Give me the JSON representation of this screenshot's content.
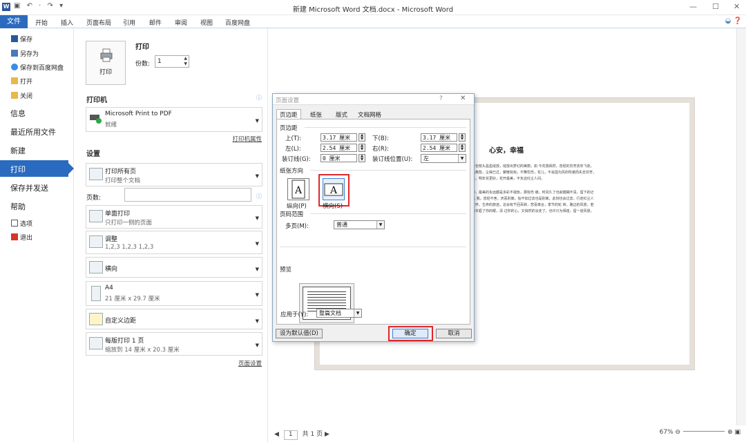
{
  "window": {
    "app_icon": "W",
    "quick_access": "▣ ↶ · ↷ ▾",
    "title": "新建 Microsoft Word 文档.docx - Microsoft Word",
    "minimize": "—",
    "maximize": "☐",
    "close": "✕"
  },
  "ribbon": {
    "file_tab": "文件",
    "tabs": [
      "开始",
      "插入",
      "页面布局",
      "引用",
      "邮件",
      "审阅",
      "视图",
      "百度网盘"
    ]
  },
  "nav": {
    "save": "保存",
    "save_as": "另存为",
    "save_to_baidu": "保存到百度网盘",
    "open": "打开",
    "close": "关闭",
    "info": "信息",
    "recent": "最近所用文件",
    "new": "新建",
    "print": "打印",
    "save_send": "保存并发送",
    "help": "帮助",
    "options": "选项",
    "exit": "退出"
  },
  "print_panel": {
    "print_button": "打印",
    "heading": "打印",
    "copies_label": "份数:",
    "copies_value": "1",
    "printer_heading": "打印机",
    "printer_name": "Microsoft Print to PDF",
    "printer_status": "就绪",
    "printer_props": "打印机属性",
    "settings_heading": "设置",
    "print_all_title": "打印所有页",
    "print_all_sub": "打印整个文档",
    "pages_label": "页数:",
    "one_sided_title": "单面打印",
    "one_sided_sub": "只打印一侧的页面",
    "collate_title": "调整",
    "collate_sub": "1,2,3    1,2,3    1,2,3",
    "orientation_title": "横向",
    "paper_title": "A4",
    "paper_sub": "21 厘米 x 29.7 厘米",
    "margins_title": "自定义边距",
    "per_sheet_title": "每版打印 1 页",
    "per_sheet_sub": "缩放到 14 厘米 x 20.3 厘米",
    "page_setup_link": "页面设置"
  },
  "preview": {
    "doc_title": "心安，幸福",
    "para_lines": [
      "着也枝头盈盈绽放，绽放出梦幻的美丽，如 今花落嫣然，曾经的芬芳流年飞逝。",
      "是离愁，尘缘已过，聚散匆匆，不舞忧伤，花儿，不会因为风的吹袭而失去芬芳，",
      "以，明年花更好，花开最美，不负这红尘人间。",
      "中，最美的永远都是多彩不褪色，那些伤 痛，时间久了也就模糊不清。留下的记",
      "北 我，曾经不舍，厌恶别离，始不如过去也是别离，此刻也会过去。行走红尘人",
      "胜怀，生命的旅途，总会有千回百转，悲喜离合，季节的轮 转，路边的风景，若",
      "也许捱了你的眼，清 过你的心，又悄然的淡走了，也许只为相逢，留一道风景。"
    ],
    "page_label": "1",
    "page_total": "共 1 页",
    "zoom_level": "67%"
  },
  "dialog": {
    "title": "页面设置",
    "help": "?",
    "close": "✕",
    "tabs": [
      "页边距",
      "纸张",
      "版式",
      "文档网格"
    ],
    "margins_group": "页边距",
    "top_label": "上(T):",
    "top_value": "3.17 厘米",
    "bottom_label": "下(B):",
    "bottom_value": "3.17 厘米",
    "left_label": "左(L):",
    "left_value": "2.54 厘米",
    "right_label": "右(R):",
    "right_value": "2.54 厘米",
    "gutter_label": "装订线(G):",
    "gutter_value": "0 厘米",
    "gutter_pos_label": "装订线位置(U):",
    "gutter_pos_value": "左",
    "orientation_group": "纸张方向",
    "portrait": "纵向(P)",
    "landscape": "横向(S)",
    "pages_group": "页码范围",
    "multi_pages_label": "多页(M):",
    "multi_pages_value": "普通",
    "preview_group": "预览",
    "apply_label": "应用于(Y):",
    "apply_value": "整篇文档",
    "default_button": "设为默认值(D)",
    "ok_button": "确定",
    "cancel_button": "取消",
    "orientation_letter": "A"
  }
}
